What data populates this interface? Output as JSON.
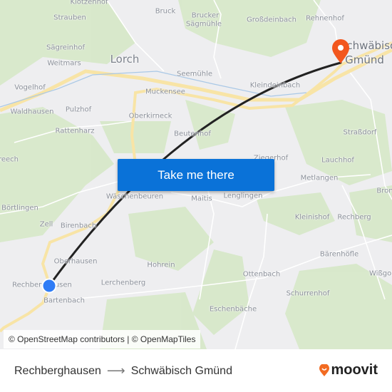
{
  "map": {
    "labels": {
      "klotzenhof": "Klotzenhof",
      "strauben": "Strauben",
      "bruck": "Bruck",
      "brucker": "Brucker",
      "saegmuehle": "Sägmühle",
      "grossdeinbach": "Großdeinbach",
      "rehnenhof": "Rehnenhof",
      "saegreinhof": "Sägreinhof",
      "lorch": "Lorch",
      "weitmars": "Weitmars",
      "seemuehle": "Seemühle",
      "vogelhof": "Vogelhof",
      "muckensee": "Muckensee",
      "kleindeinbach": "Kleindeinbach",
      "waldhausen": "Waldhausen",
      "pulzhof": "Pulzhof",
      "oberkirneck": "Oberkirneck",
      "rattenharz": "Rattenharz",
      "beutenhof": "Beutenhof",
      "strassdorf": "Straßdorf",
      "reech": "reech",
      "ziegerhof": "Ziegerhof",
      "lauchhof": "Lauchhof",
      "metlangen": "Metlangen",
      "waeschenbeuren": "Wäschenbeuren",
      "maitis": "Maitis",
      "lenglingen": "Lenglingen",
      "boertlingen": "Börtlingen",
      "bron": "Bron",
      "zell": "Zell",
      "birenbach": "Birenbach",
      "kleinishof": "Kleinishof",
      "rechberg": "Rechberg",
      "baerenhoefle": "Bärenhöfle",
      "oberhausen": "Oberhausen",
      "hohrein": "Hohrein",
      "wissgol": "Wißgol",
      "rechberghausen": "Rechberghausen",
      "lerchenberg": "Lerchenberg",
      "ottenbach": "Ottenbach",
      "bartenbach": "Bartenbach",
      "schurrenhof": "Schurrenhof",
      "eschenbaeche": "Eschenbäche",
      "schwaebisch": "Schwäbisch",
      "gmuend": "Gmünd"
    },
    "cta_label": "Take me there",
    "attribution": "© OpenStreetMap contributors | © OpenMapTiles",
    "origin_marker_color": "#2f7cf6",
    "destination_marker_color": "#f2561d",
    "route_color": "#222222"
  },
  "footer": {
    "origin": "Rechberghausen",
    "destination": "Schwäbisch Gmünd",
    "arrow_icon": "arrow-right-icon",
    "logo_text": "moovit",
    "logo_color": "#f26b22"
  }
}
